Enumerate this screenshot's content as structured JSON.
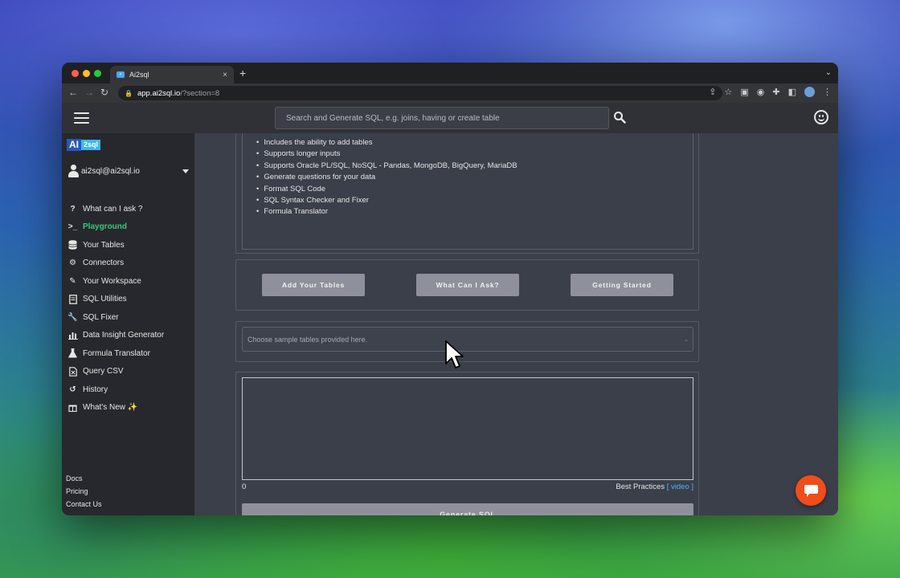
{
  "browser": {
    "tab_title": "Ai2sql",
    "tab_close": "×",
    "new_tab": "+",
    "url_host": "app.ai2sql.io",
    "url_path": "/?section=8"
  },
  "header": {
    "search_placeholder": "Search and Generate SQL, e.g. joins, having or create table"
  },
  "sidebar": {
    "logo_ai": "AI",
    "logo_sql": "2sql",
    "user_email": "ai2sql@ai2sql.io",
    "items": [
      {
        "label": "What can I ask ?",
        "icon": "question-icon"
      },
      {
        "label": "Playground",
        "icon": "terminal-icon"
      },
      {
        "label": "Your Tables",
        "icon": "database-icon"
      },
      {
        "label": "Connectors",
        "icon": "gear-icon"
      },
      {
        "label": "Your Workspace",
        "icon": "edit-icon"
      },
      {
        "label": "SQL Utilities",
        "icon": "document-icon"
      },
      {
        "label": "SQL Fixer",
        "icon": "wrench-icon"
      },
      {
        "label": "Data Insight Generator",
        "icon": "bar-chart-icon"
      },
      {
        "label": "Formula Translator",
        "icon": "flask-icon"
      },
      {
        "label": "Query CSV",
        "icon": "csv-file-icon"
      },
      {
        "label": "History",
        "icon": "history-icon"
      },
      {
        "label": "What's New ✨",
        "icon": "gift-icon"
      }
    ],
    "active_item": "Playground",
    "footer": {
      "docs": "Docs",
      "pricing": "Pricing",
      "contact": "Contact Us"
    }
  },
  "main": {
    "features": [
      "Includes the ability to add tables",
      "Supports longer inputs",
      "Supports Oracle PL/SQL, NoSQL - Pandas, MongoDB, BigQuery, MariaDB",
      "Generate questions for your data",
      "Format SQL Code",
      "SQL Syntax Checker and Fixer",
      "Formula Translator"
    ],
    "buttons": {
      "add_tables": "Add Your Tables",
      "what_can_i_ask": "What Can I Ask?",
      "getting_started": "Getting Started"
    },
    "sample_select_placeholder": "Choose sample tables provided here.",
    "char_count": "0",
    "best_practices": "Best Practices",
    "video_link": "[ video ]",
    "generate_label": "Generate SQL"
  },
  "colors": {
    "active_nav": "#37c97a",
    "chat_fab": "#f04d1a",
    "link": "#4ab4ff"
  }
}
